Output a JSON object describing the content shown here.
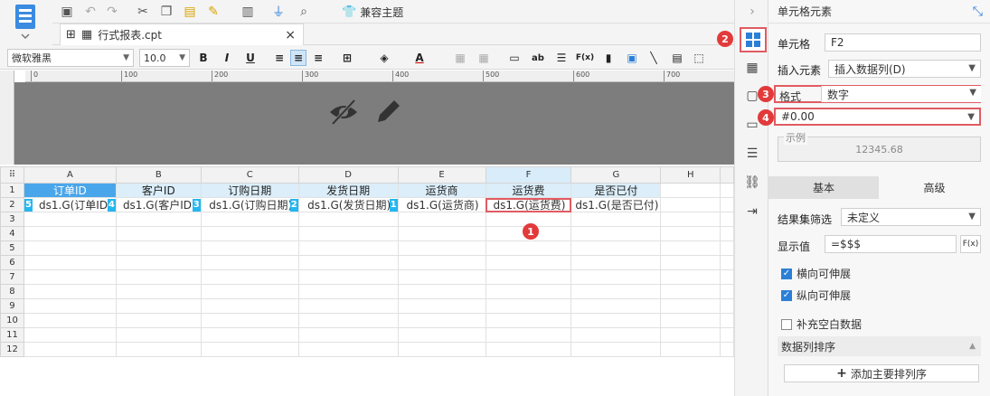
{
  "toolbar": {
    "compat_theme_label": "兼容主题"
  },
  "tab": {
    "filename": "行式报表.cpt",
    "close": "×"
  },
  "format_bar": {
    "font_name": "微软雅黑",
    "font_size": "10.0",
    "bold": "B",
    "italic": "I",
    "underline": "U",
    "text_a": "A",
    "ab": "ab",
    "fx": "F(x)"
  },
  "ruler": {
    "ticks": [
      "0",
      "100",
      "200",
      "300",
      "400",
      "500",
      "600",
      "700"
    ]
  },
  "sheet": {
    "corner": "⠿",
    "columns": [
      "A",
      "B",
      "C",
      "D",
      "E",
      "F",
      "G",
      "H"
    ],
    "row_numbers": [
      "1",
      "2",
      "3",
      "4",
      "5",
      "6",
      "7",
      "8",
      "9",
      "10",
      "11",
      "12"
    ],
    "headers": [
      "订单ID",
      "客户ID",
      "订购日期",
      "发货日期",
      "运货商",
      "运货费",
      "是否已付"
    ],
    "data_cells": [
      "ds1.G(订单ID)",
      "ds1.G(客户ID)",
      "ds1.G(订购日期)",
      "ds1.G(发货日期)",
      "ds1.G(运货商)",
      "ds1.G(运货费)",
      "ds1.G(是否已付)"
    ],
    "cell_badges": [
      "5",
      "4",
      "3",
      "2",
      "1"
    ]
  },
  "markers": {
    "m1": "1",
    "m2": "2",
    "m3": "3",
    "m4": "4"
  },
  "panel": {
    "title": "单元格元素",
    "cell_label": "单元格",
    "cell_value": "F2",
    "insert_label": "插入元素",
    "insert_value": "插入数据列(D)",
    "format_label": "格式",
    "format_value": "数字",
    "pattern_value": "#0.00",
    "example_label": "示例",
    "example_value": "12345.68",
    "tab_basic": "基本",
    "tab_advanced": "高级",
    "filter_label": "结果集筛选",
    "filter_value": "未定义",
    "display_label": "显示值",
    "display_value": "=$$$",
    "display_fx": "F(x)",
    "check_h": "横向可伸展",
    "check_v": "纵向可伸展",
    "check_fill": "补充空白数据",
    "sort_label": "数据列排序",
    "add_sort_button": "添加主要排列序"
  },
  "colors": {
    "accent": "#2b7fd6",
    "highlight": "#e05b62",
    "header_sel": "#4aa6ea",
    "badge": "#24b7ef"
  }
}
